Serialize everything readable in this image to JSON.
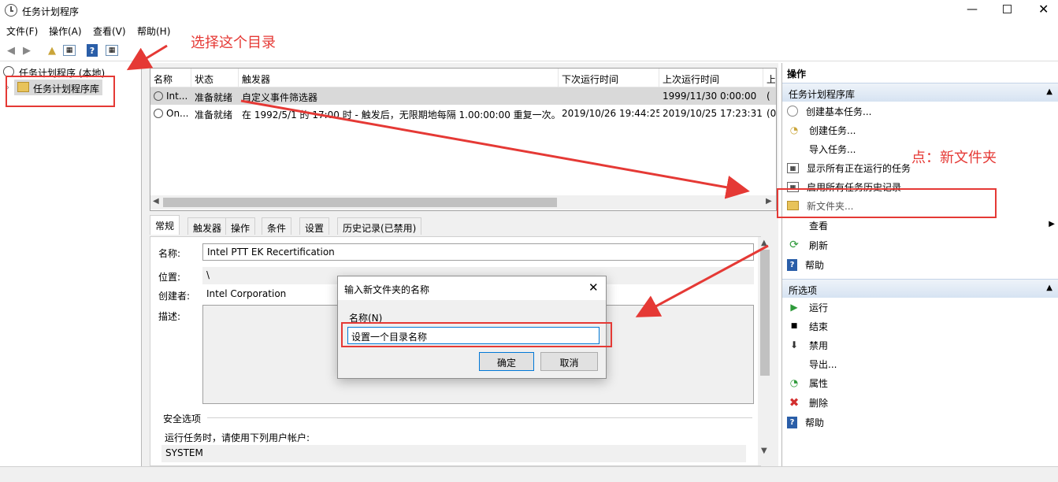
{
  "window": {
    "title": "任务计划程序"
  },
  "menu": [
    "文件(F)",
    "操作(A)",
    "查看(V)",
    "帮助(H)"
  ],
  "tree": {
    "root": "任务计划程序 (本地)",
    "child": "任务计划程序库"
  },
  "table": {
    "columns": [
      "名称",
      "状态",
      "触发器",
      "下次运行时间",
      "上次运行时间",
      "上"
    ],
    "rows": [
      [
        "Int...",
        "准备就绪",
        "自定义事件筛选器",
        "",
        "1999/11/30 0:00:00",
        "("
      ],
      [
        "On...",
        "准备就绪",
        "在 1992/5/1 的 17:00 时 - 触发后，无限期地每隔 1.00:00:00 重复一次。",
        "2019/10/26 19:44:25",
        "2019/10/25 17:23:31",
        "(0"
      ]
    ]
  },
  "tabs": [
    "常规",
    "触发器",
    "操作",
    "条件",
    "设置",
    "历史记录(已禁用)"
  ],
  "detail": {
    "name_label": "名称:",
    "name_value": "Intel PTT EK Recertification",
    "location_label": "位置:",
    "location_value": "\\",
    "author_label": "创建者:",
    "author_value": "Intel Corporation",
    "desc_label": "描述:",
    "security_title": "安全选项",
    "run_as_text": "运行任务时，请使用下列用户帐户:",
    "user": "SYSTEM"
  },
  "actions": {
    "title": "操作",
    "section1": "任务计划程序库",
    "items1": [
      "创建基本任务...",
      "创建任务...",
      "导入任务...",
      "显示所有正在运行的任务",
      "启用所有任务历史记录",
      "新文件夹...",
      "查看",
      "刷新",
      "帮助"
    ],
    "section2": "所选项",
    "items2": [
      "运行",
      "结束",
      "禁用",
      "导出...",
      "属性",
      "删除",
      "帮助"
    ]
  },
  "dialog": {
    "title": "输入新文件夹的名称",
    "label": "名称(N)",
    "value": "设置一个目录名称",
    "ok": "确定",
    "cancel": "取消"
  },
  "annotations": {
    "select_dir": "选择这个目录",
    "click_new_folder": "点：新文件夹"
  },
  "colors": {
    "annotation": "#e53935",
    "section_header": "#d6e3f2",
    "selected_row": "#d9d9d9"
  }
}
